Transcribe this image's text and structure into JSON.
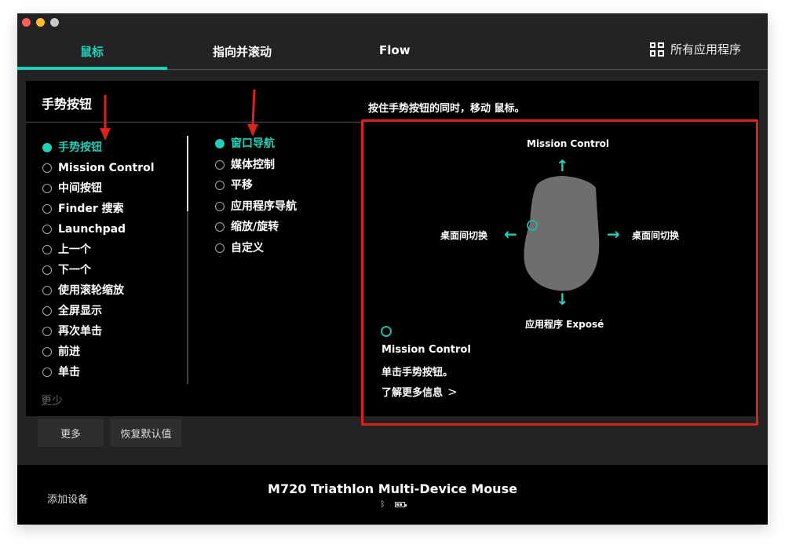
{
  "window": {
    "traffic_lights": [
      "close",
      "minimize",
      "maximize"
    ]
  },
  "tabs": [
    {
      "label": "鼠标",
      "active": true
    },
    {
      "label": "指向并滚动",
      "active": false
    },
    {
      "label": "Flow",
      "active": false
    }
  ],
  "all_apps": {
    "label": "所有应用程序",
    "icon": "grid-icon"
  },
  "panel": {
    "title": "手势按钮",
    "instruction": "按住手势按钮的同时，移动 鼠标。",
    "left_options": [
      {
        "label": "手势按钮",
        "selected": true
      },
      {
        "label": "Mission Control",
        "selected": false
      },
      {
        "label": "中间按钮",
        "selected": false
      },
      {
        "label": "Finder 搜索",
        "selected": false
      },
      {
        "label": "Launchpad",
        "selected": false
      },
      {
        "label": "上一个",
        "selected": false
      },
      {
        "label": "下一个",
        "selected": false
      },
      {
        "label": "使用滚轮缩放",
        "selected": false
      },
      {
        "label": "全屏显示",
        "selected": false
      },
      {
        "label": "再次单击",
        "selected": false
      },
      {
        "label": "前进",
        "selected": false
      },
      {
        "label": "单击",
        "selected": false
      }
    ],
    "less_label": "更少",
    "right_options": [
      {
        "label": "窗口导航",
        "selected": true
      },
      {
        "label": "媒体控制",
        "selected": false
      },
      {
        "label": "平移",
        "selected": false
      },
      {
        "label": "应用程序导航",
        "selected": false
      },
      {
        "label": "缩放/旋转",
        "selected": false
      },
      {
        "label": "自定义",
        "selected": false
      }
    ],
    "gestures": {
      "up": "Mission Control",
      "left": "桌面间切换",
      "right": "桌面间切换",
      "down": "应用程序 Exposé"
    },
    "info": {
      "title": "Mission Control",
      "description": "单击手势按钮。",
      "learn_more": "了解更多信息"
    }
  },
  "buttons": {
    "more": "更多",
    "reset": "恢复默认值"
  },
  "footer": {
    "add_device": "添加设备",
    "device_name": "M720 Triathlon Multi-Device Mouse",
    "connection": "bluetooth",
    "battery_level": "medium"
  },
  "colors": {
    "accent": "#20d0b8",
    "highlight_box": "#d9231b",
    "background": "#232323",
    "panel": "#000000"
  }
}
